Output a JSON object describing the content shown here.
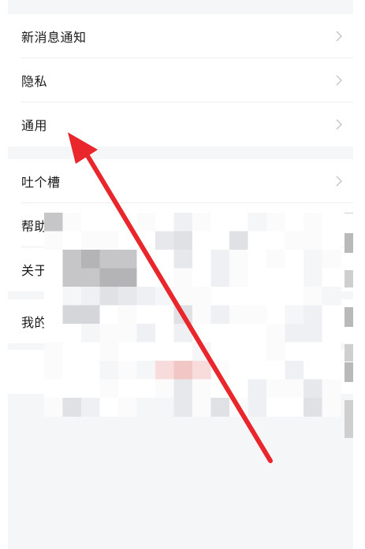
{
  "settings": {
    "group1": [
      {
        "label": "新消息通知",
        "icon": "chevron-right-icon"
      },
      {
        "label": "隐私",
        "icon": "chevron-right-icon"
      },
      {
        "label": "通用",
        "icon": "chevron-right-icon"
      }
    ],
    "group2": [
      {
        "label": "吐个槽",
        "icon": "chevron-right-icon"
      },
      {
        "label": "帮助"
      },
      {
        "label": "关于"
      }
    ],
    "group3": [
      {
        "label": "我的"
      }
    ]
  },
  "colors": {
    "background": "#f5f6f8",
    "annotation_arrow": "#e8262b"
  }
}
